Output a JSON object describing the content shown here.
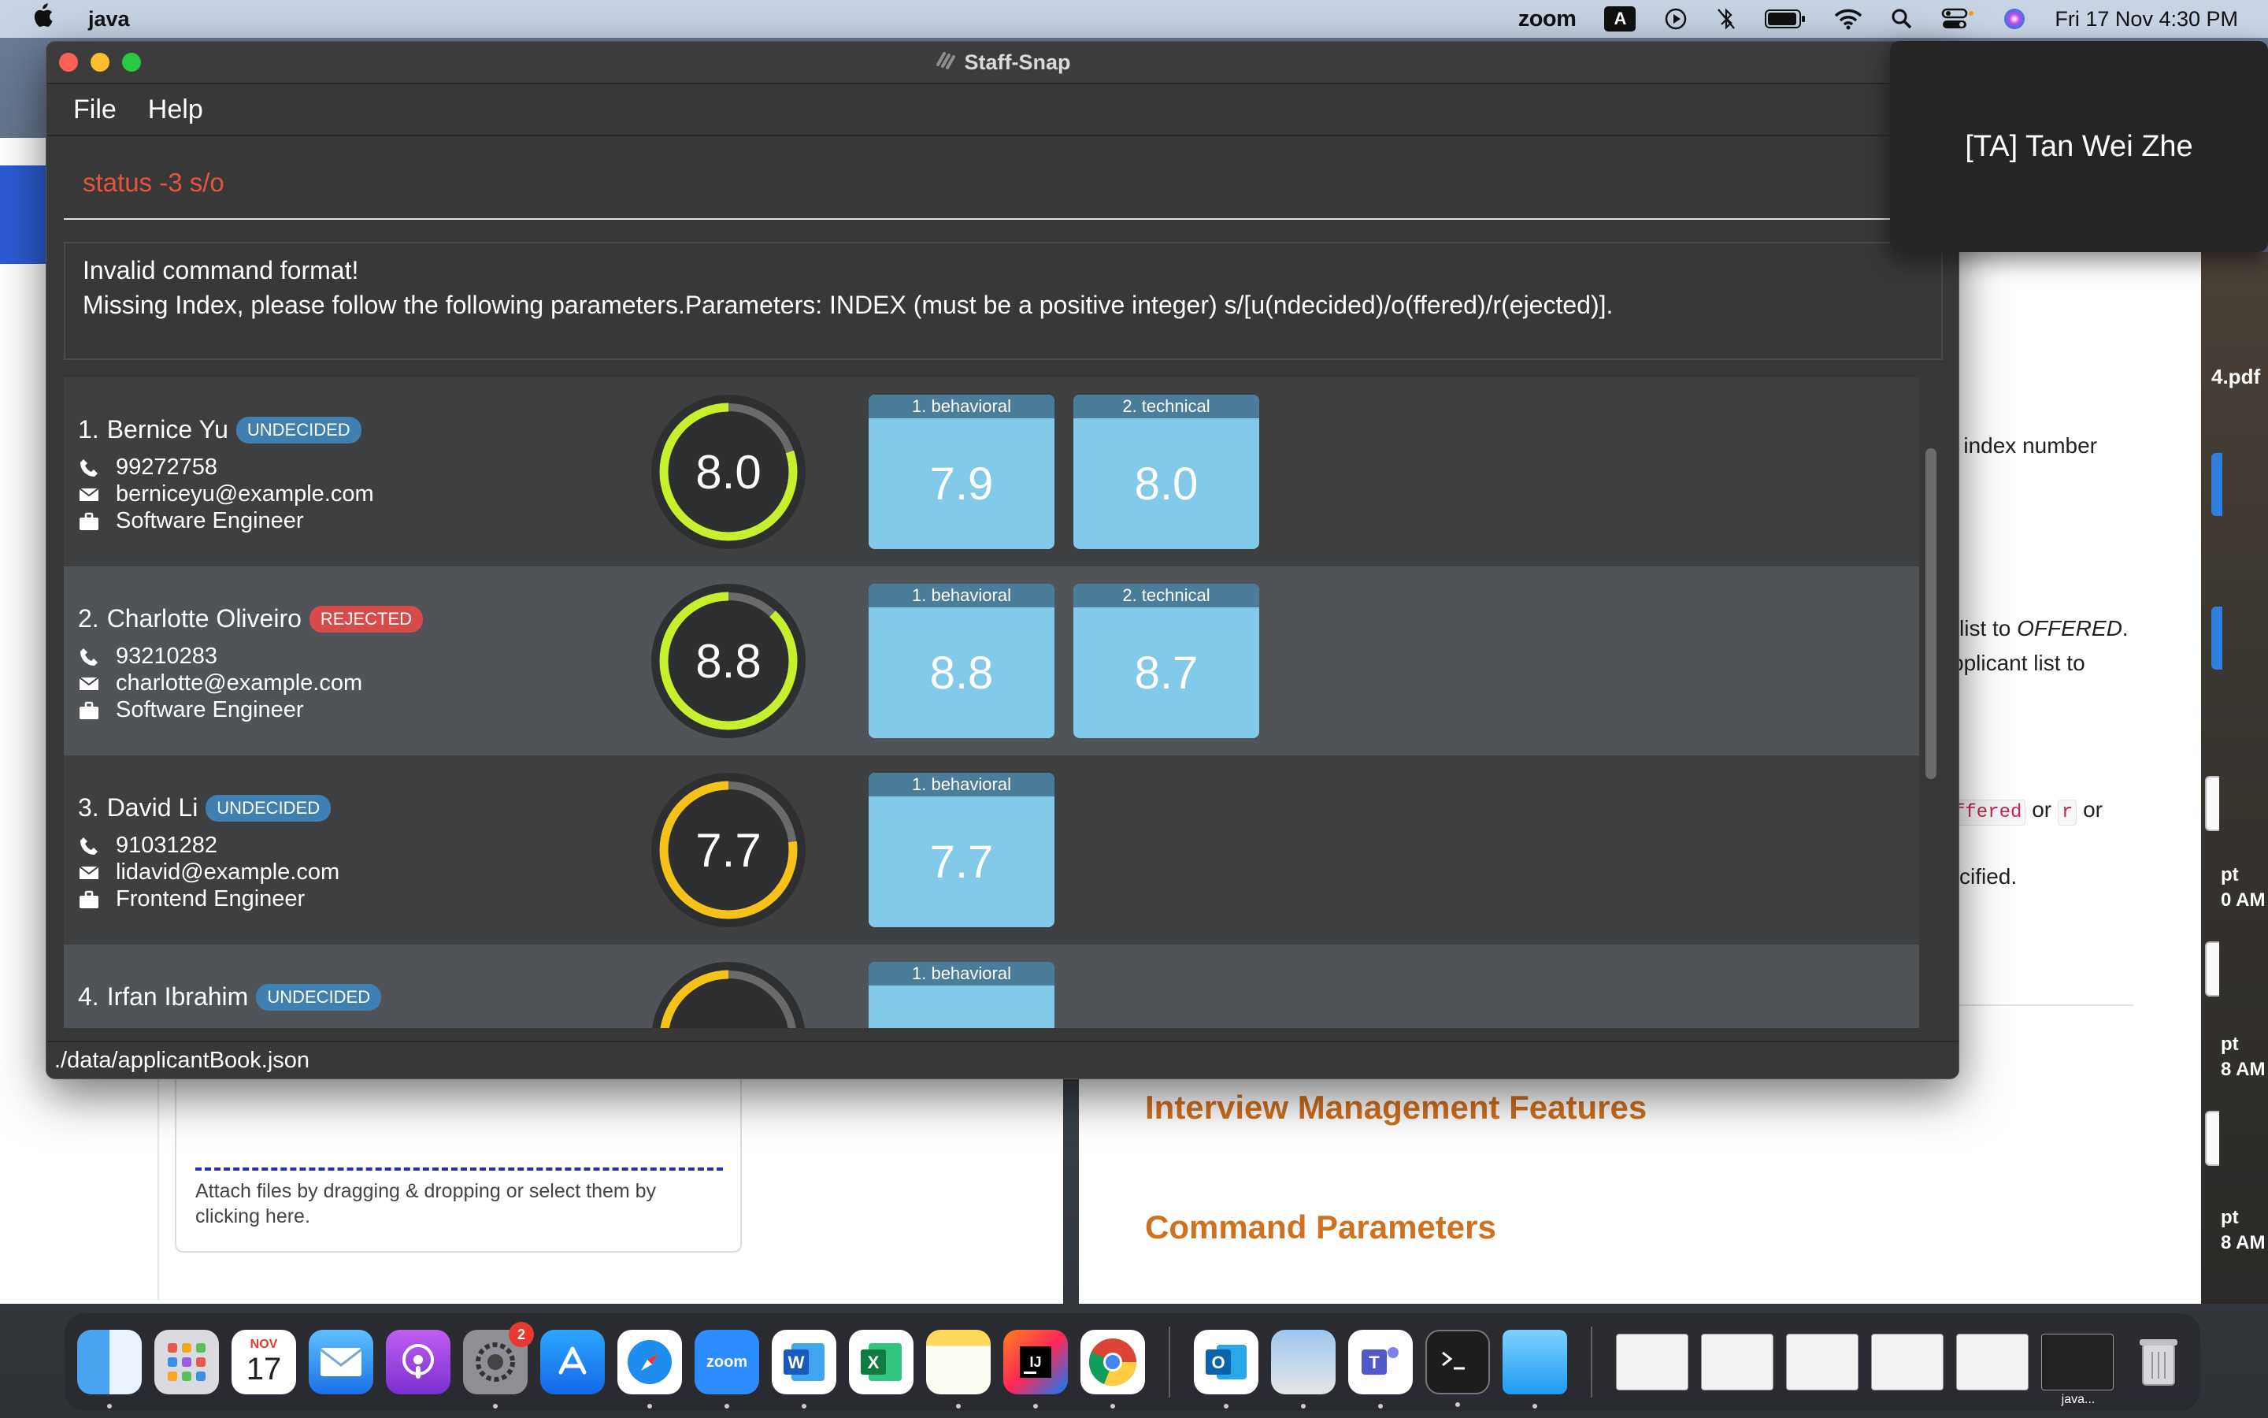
{
  "menubar": {
    "app_name": "java",
    "zoom": "zoom",
    "input_source": "A",
    "datetime": "Fri 17 Nov  4:30 PM"
  },
  "window": {
    "title": "Staff-Snap",
    "menu": [
      "File",
      "Help"
    ],
    "command_input": "status -3 s/o",
    "result": {
      "line1": "Invalid command format!",
      "line2": "Missing Index, please follow the following parameters.Parameters: INDEX (must be a positive integer) s/[u(ndecided)/o(ffered)/r(ejected)]."
    },
    "status_bar": "./data/applicantBook.json"
  },
  "applicants": [
    {
      "index": "1.",
      "name": "Bernice Yu",
      "status": "UNDECIDED",
      "phone": "99272758",
      "email": "berniceyu@example.com",
      "position": "Software Engineer",
      "score": "8.0",
      "score_fraction": 0.8,
      "ring_color": "#c6f02d",
      "interviews": [
        {
          "label": "1. behavioral",
          "score": "7.9"
        },
        {
          "label": "2. technical",
          "score": "8.0"
        }
      ]
    },
    {
      "index": "2.",
      "name": "Charlotte Oliveiro",
      "status": "REJECTED",
      "phone": "93210283",
      "email": "charlotte@example.com",
      "position": "Software Engineer",
      "score": "8.8",
      "score_fraction": 0.88,
      "ring_color": "#c6f02d",
      "interviews": [
        {
          "label": "1. behavioral",
          "score": "8.8"
        },
        {
          "label": "2. technical",
          "score": "8.7"
        }
      ]
    },
    {
      "index": "3.",
      "name": "David Li",
      "status": "UNDECIDED",
      "phone": "91031282",
      "email": "lidavid@example.com",
      "position": "Frontend Engineer",
      "score": "7.7",
      "score_fraction": 0.77,
      "ring_color": "#f6c21a",
      "interviews": [
        {
          "label": "1. behavioral",
          "score": "7.7"
        }
      ]
    },
    {
      "index": "4.",
      "name": "Irfan Ibrahim",
      "status": "UNDECIDED",
      "score_fraction": 0.5,
      "ring_color": "#f6c21a",
      "interviews": [
        {
          "label": "1. behavioral",
          "score": ""
        }
      ]
    }
  ],
  "overlay": {
    "text": "[TA] Tan Wei Zhe"
  },
  "background": {
    "attach_text": "Attach files by dragging & dropping or select them by clicking here.",
    "doc_line1": "e index number",
    "doc_line2a": " list to ",
    "doc_line2b": "OFFERED",
    "doc_line2c": ".",
    "doc_line3": "pplicant list to",
    "doc_code1": "ffered",
    "doc_or1": " or ",
    "doc_code2": "r",
    "doc_or2": " or",
    "doc_line5": "cified.",
    "heading1": "Interview Management Features",
    "heading2": "Command Parameters",
    "pdf_label": "4.pdf",
    "edge1a": "pt",
    "edge1b": "0 AM",
    "edge2a": "pt",
    "edge2b": "8 AM",
    "edge3a": "pt",
    "edge3b": "8 AM"
  },
  "dock": {
    "calendar_month": "NOV",
    "calendar_day": "17",
    "settings_badge": "2",
    "zoom_label": "zoom",
    "java_label": "java..."
  }
}
